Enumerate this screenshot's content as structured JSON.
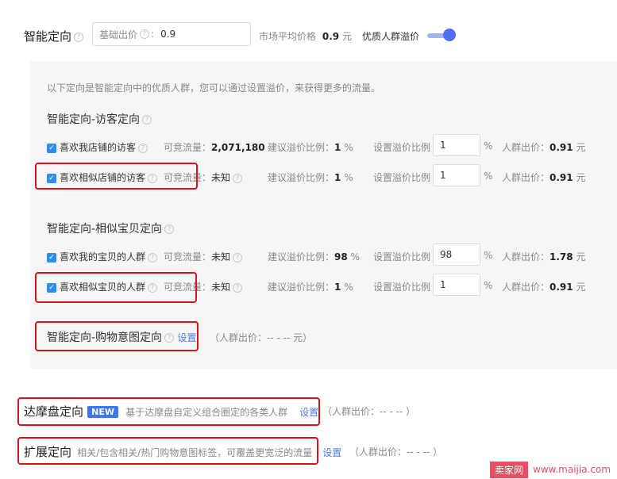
{
  "header": {
    "title": "智能定向",
    "bid_label": "基础出价",
    "bid_value": "0.9",
    "market_avg_label": "市场平均价格",
    "market_avg_value": "0.9",
    "market_avg_unit": "元",
    "premium_label": "优质人群溢价",
    "premium_enabled": true
  },
  "panel": {
    "description": "以下定向是智能定向中的优质人群，您可以通过设置溢价，来获得更多的流量。",
    "visitor_section": {
      "title": "智能定向-访客定向",
      "rows": [
        {
          "label": "喜欢我店铺的访客",
          "traffic_label": "可竞流量：",
          "traffic_value": "2,071,180",
          "suggest_label": "建议溢价比例：",
          "suggest_value": "1",
          "suggest_unit": "%",
          "set_label": "设置溢价比例",
          "set_value": "1",
          "set_unit": "%",
          "crowd_label": "人群出价：",
          "crowd_value": "0.91",
          "crowd_unit": "元",
          "checked": true
        },
        {
          "label": "喜欢相似店铺的访客",
          "traffic_label": "可竞流量：",
          "traffic_value": "未知",
          "suggest_label": "建议溢价比例：",
          "suggest_value": "1",
          "suggest_unit": "%",
          "set_label": "设置溢价比例",
          "set_value": "1",
          "set_unit": "%",
          "crowd_label": "人群出价：",
          "crowd_value": "0.91",
          "crowd_unit": "元",
          "checked": true
        }
      ]
    },
    "item_section": {
      "title": "智能定向-相似宝贝定向",
      "rows": [
        {
          "label": "喜欢我的宝贝的人群",
          "traffic_label": "可竞流量：",
          "traffic_value": "未知",
          "suggest_label": "建议溢价比例：",
          "suggest_value": "98",
          "suggest_unit": "%",
          "set_label": "设置溢价比例",
          "set_value": "98",
          "set_unit": "%",
          "crowd_label": "人群出价：",
          "crowd_value": "1.78",
          "crowd_unit": "元",
          "checked": true
        },
        {
          "label": "喜欢相似宝贝的人群",
          "traffic_label": "可竞流量：",
          "traffic_value": "未知",
          "suggest_label": "建议溢价比例：",
          "suggest_value": "1",
          "suggest_unit": "%",
          "set_label": "设置溢价比例",
          "set_value": "1",
          "set_unit": "%",
          "crowd_label": "人群出价：",
          "crowd_value": "0.91",
          "crowd_unit": "元",
          "checked": true
        }
      ]
    },
    "shopping_intent": {
      "title": "智能定向-购物意图定向",
      "set_link": "设置",
      "crowd_price": "（人群出价：-- - -- 元）"
    }
  },
  "damopan": {
    "title": "达摩盘定向",
    "badge": "NEW",
    "desc": "基于达摩盘自定义组合圈定的各类人群",
    "set_link": "设置",
    "crowd_price": "（人群出价：-- - -- ）"
  },
  "extend": {
    "title": "扩展定向",
    "desc": "相关/包含相关/热门购物意图标签，可覆盖更宽泛的流量",
    "set_link": "设置",
    "crowd_price": "（人群出价：-- - -- ）"
  },
  "watermark": {
    "brand": "卖家网",
    "url": "www.maijia.com"
  },
  "colors": {
    "accent": "#4a78e6",
    "highlight_box": "#d9121b",
    "panel_bg": "#f6f6f7",
    "checkbox": "#2d8cf0"
  }
}
